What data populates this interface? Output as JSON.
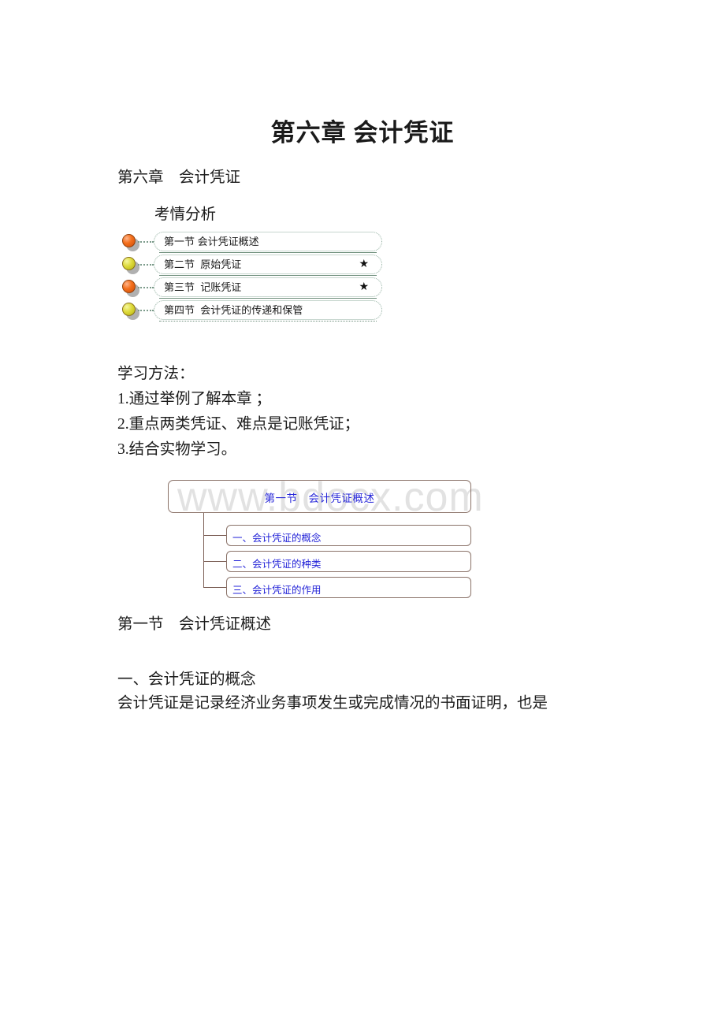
{
  "document": {
    "title": "第六章 会计凭证",
    "chapter_line": "第六章    会计凭证",
    "exam_analysis_label": "考情分析",
    "watermark": "www.bdocx.com"
  },
  "nav_outline": {
    "items": [
      {
        "label": "第一节 会计凭证概述",
        "bullet": "orange-sphere-bullet",
        "star": ""
      },
      {
        "label": "第二节  原始凭证",
        "bullet": "yellow-sphere-bullet",
        "star": "★"
      },
      {
        "label": "第三节  记账凭证",
        "bullet": "orange-sphere-bullet",
        "star": "★"
      },
      {
        "label": "第四节  会计凭证的传递和保管",
        "bullet": "yellow-sphere-bullet",
        "star": ""
      }
    ]
  },
  "study_method": {
    "heading": "学习方法：",
    "line1": "1.通过举例了解本章 ；",
    "line2": "2.重点两类凭证、难点是记账凭证；",
    "line3": "3.结合实物学习。"
  },
  "tree_diagram": {
    "root": "第一节　会计凭证概述",
    "nodes": [
      "一、会计凭证的概念",
      "二、会计凭证的种类",
      "三、会计凭证的作用"
    ],
    "box_border_color": "#8a7268",
    "text_color": "#2525d8",
    "connector_color": "#7b5e55"
  },
  "body": {
    "section_heading": "第一节    会计凭证概述",
    "subsection_heading": "一、会计凭证的概念",
    "paragraph": "会计凭证是记录经济业务事项发生或完成情况的书面证明，也是"
  }
}
